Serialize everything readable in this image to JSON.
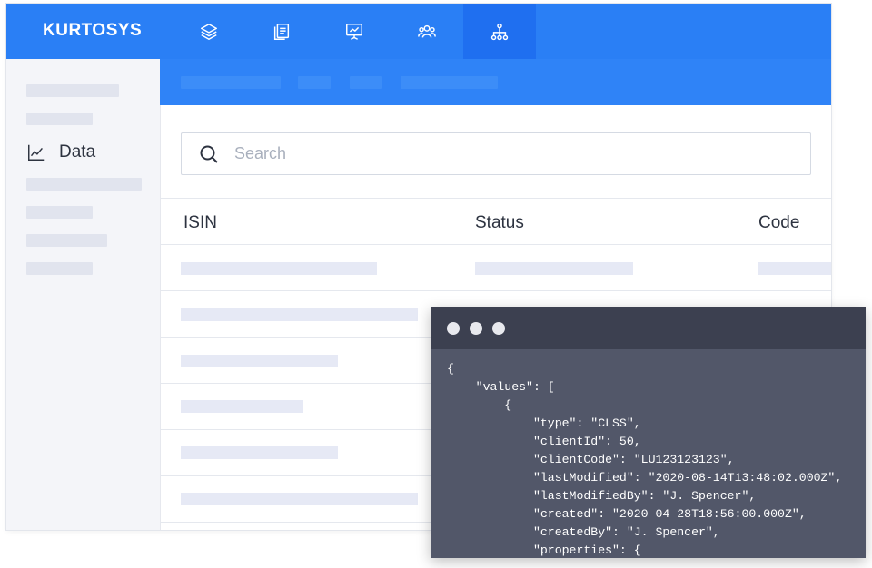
{
  "header": {
    "logo": "KURTOSYS",
    "nav_icons": [
      "layers-icon",
      "documents-icon",
      "presentation-icon",
      "users-icon",
      "sitemap-icon"
    ],
    "active_nav": "sitemap-icon",
    "accent_color": "#2a7ff5"
  },
  "sidebar": {
    "active_item_label": "Data",
    "active_item_icon": "line-chart-icon"
  },
  "search": {
    "placeholder": "Search",
    "value": ""
  },
  "table": {
    "columns": [
      "ISIN",
      "Status",
      "Code"
    ]
  },
  "code_window": {
    "lines": [
      "{",
      "    \"values\": [",
      "        {",
      "            \"type\": \"CLSS\",",
      "            \"clientId\": 50,",
      "            \"clientCode\": \"LU123123123\",",
      "            \"lastModified\": \"2020-08-14T13:48:02.000Z\",",
      "            \"lastModifiedBy\": \"J. Spencer\",",
      "            \"created\": \"2020-04-28T18:56:00.000Z\",",
      "            \"createdBy\": \"J. Spencer\",",
      "            \"properties\": {"
    ]
  }
}
